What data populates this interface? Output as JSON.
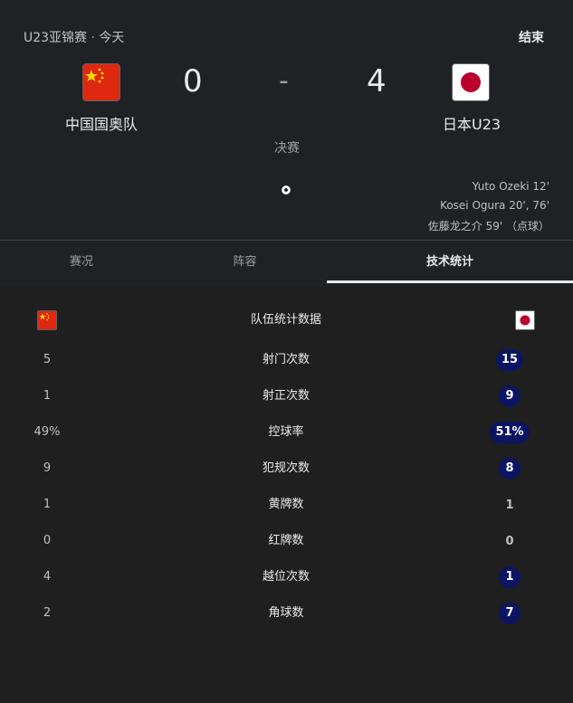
{
  "header": {
    "competition": "U23亚锦赛",
    "separator": "·",
    "date": "今天",
    "status": "结束"
  },
  "match": {
    "home": {
      "name": "中国国奥队",
      "score": "0",
      "flag": "china-flag-icon"
    },
    "away": {
      "name": "日本U23",
      "score": "4",
      "flag": "japan-flag-icon"
    },
    "score_separator": "-",
    "round": "决赛",
    "goal_icon": "soccer-ball-icon",
    "away_scorers": [
      "Yuto Ozeki 12'",
      "Kosei Ogura 20', 76'",
      "佐藤龙之介 59' （点球）"
    ]
  },
  "tabs": [
    {
      "label": "赛况",
      "active": false
    },
    {
      "label": "阵容",
      "active": false
    },
    {
      "label": "技术统计",
      "active": true
    }
  ],
  "stats": {
    "header_label": "队伍统计数据",
    "rows": [
      {
        "label": "射门次数",
        "home": "5",
        "away": "15",
        "away_highlight": true
      },
      {
        "label": "射正次数",
        "home": "1",
        "away": "9",
        "away_highlight": true
      },
      {
        "label": "控球率",
        "home": "49%",
        "away": "51%",
        "away_highlight": true
      },
      {
        "label": "犯规次数",
        "home": "9",
        "away": "8",
        "away_highlight": true
      },
      {
        "label": "黄牌数",
        "home": "1",
        "away": "1",
        "away_highlight": false
      },
      {
        "label": "红牌数",
        "home": "0",
        "away": "0",
        "away_highlight": false
      },
      {
        "label": "越位次数",
        "home": "4",
        "away": "1",
        "away_highlight": true
      },
      {
        "label": "角球数",
        "home": "2",
        "away": "7",
        "away_highlight": true
      }
    ]
  },
  "colors": {
    "background": "#202124",
    "highlight_pill": "#0b1563",
    "china_red": "#de2910",
    "china_yellow": "#ffde00",
    "japan_red": "#bc002d"
  }
}
